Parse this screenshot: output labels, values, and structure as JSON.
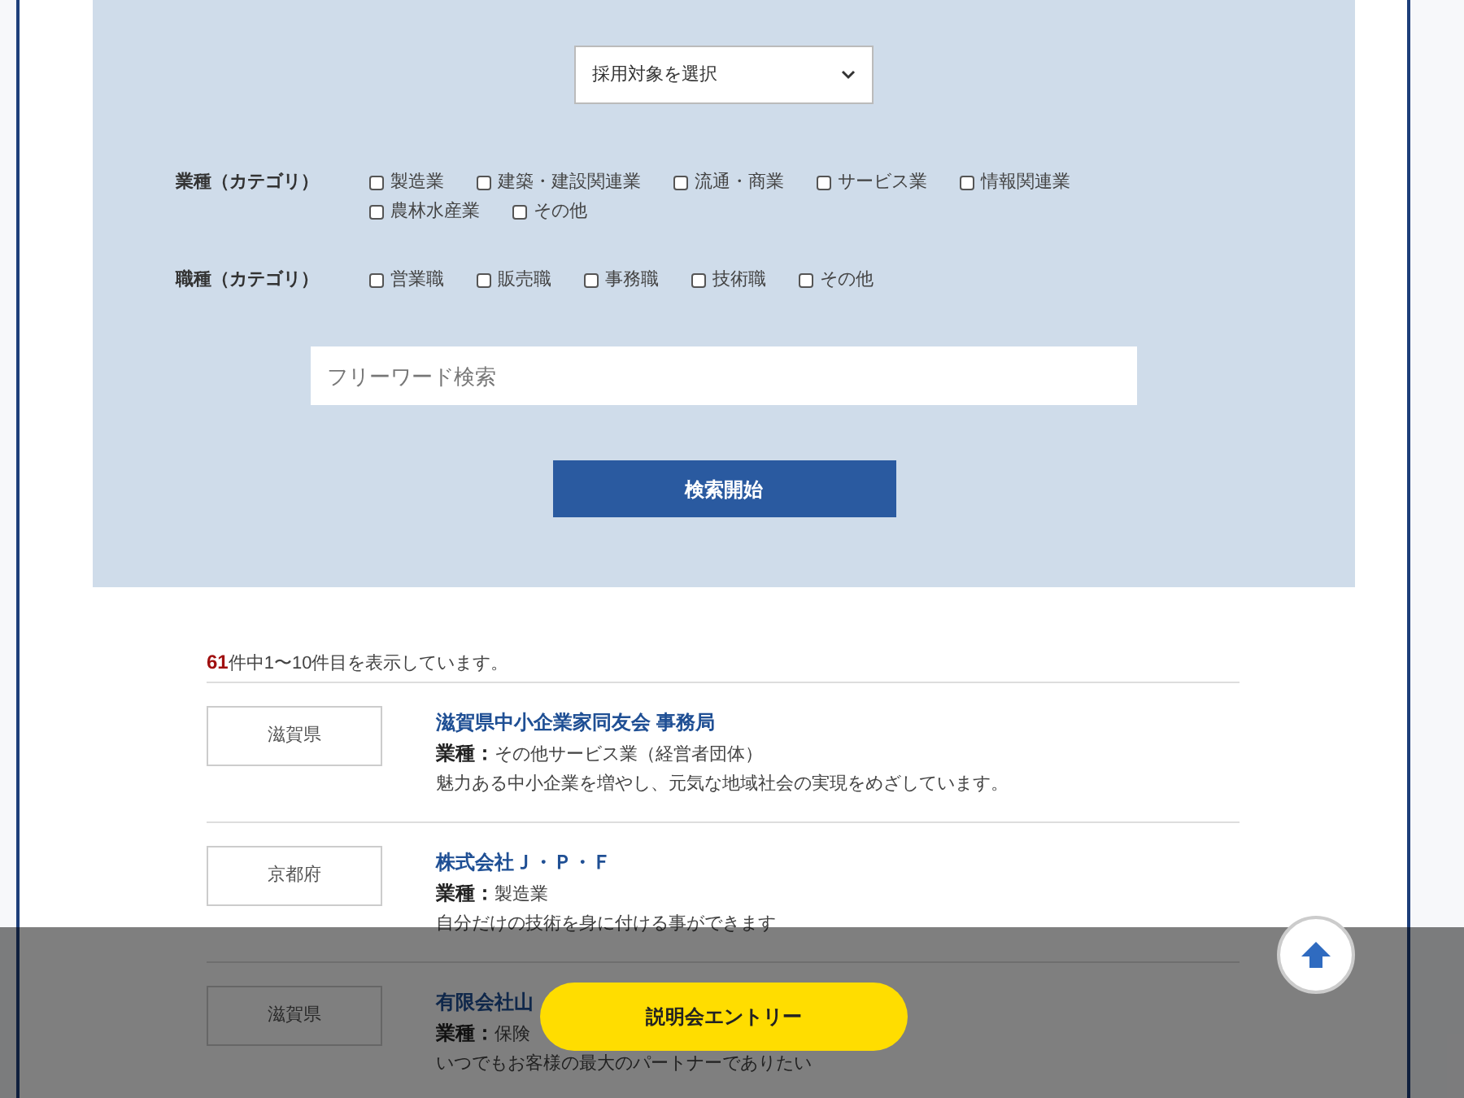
{
  "search_panel": {
    "select": {
      "value": "採用対象を選択"
    },
    "filters": [
      {
        "label": "業種（カテゴリ）",
        "options": [
          {
            "label": "製造業",
            "checked": false
          },
          {
            "label": "建築・建設関連業",
            "checked": false
          },
          {
            "label": "流通・商業",
            "checked": false
          },
          {
            "label": "サービス業",
            "checked": false
          },
          {
            "label": "情報関連業",
            "checked": false
          },
          {
            "label": "農林水産業",
            "checked": false
          },
          {
            "label": "その他",
            "checked": false
          }
        ]
      },
      {
        "label": "職種（カテゴリ）",
        "options": [
          {
            "label": "営業職",
            "checked": false
          },
          {
            "label": "販売職",
            "checked": false
          },
          {
            "label": "事務職",
            "checked": false
          },
          {
            "label": "技術職",
            "checked": false
          },
          {
            "label": "その他",
            "checked": false
          }
        ]
      }
    ],
    "keyword": {
      "placeholder": "フリーワード検索"
    },
    "submit": "検索開始"
  },
  "results": {
    "total": "61",
    "summary": "件中1〜10件目を表示しています。",
    "items": [
      {
        "prefecture": "滋賀県",
        "company": "滋賀県中小企業家同友会 事務局",
        "industry_label": "業種：",
        "industry": "その他サービス業（経営者団体）",
        "description": "魅力ある中小企業を増やし、元気な地域社会の実現をめざしています。"
      },
      {
        "prefecture": "京都府",
        "company": "株式会社Ｊ・Ｐ・Ｆ",
        "industry_label": "業種：",
        "industry": "製造業",
        "description": "自分だけの技術を身に付ける事ができます"
      },
      {
        "prefecture": "滋賀県",
        "company": "有限会社山",
        "industry_label": "業種：",
        "industry": "保険",
        "description": "いつでもお客様の最大のパートナーでありたい"
      }
    ]
  },
  "footer_bar": {
    "entry_button": "説明会エントリー"
  }
}
